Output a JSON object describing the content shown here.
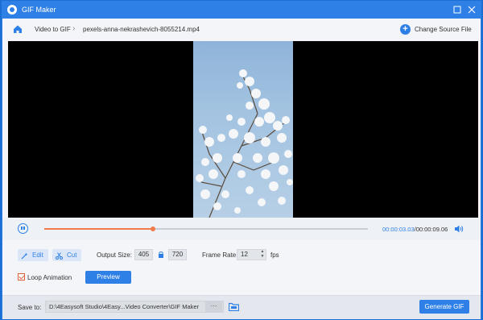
{
  "window": {
    "title": "GIF Maker"
  },
  "toolbar": {
    "breadcrumb_root": "Video to GIF",
    "breadcrumb_file": "pexels-anna-nekrashevich-8055214.mp4",
    "change_source_label": "Change Source File"
  },
  "playback": {
    "current_time": "00:00:03.03",
    "total_time": "/00:00:09.06",
    "progress_fraction": 0.335
  },
  "settings": {
    "edit_label": "Edit",
    "cut_label": "Cut",
    "output_size_label": "Output Size:",
    "width": "405",
    "height": "720",
    "frame_rate_label": "Frame Rate:",
    "frame_rate": "12",
    "fps_label": "fps",
    "loop_label": "Loop Animation",
    "loop_checked": true,
    "preview_label": "Preview"
  },
  "footer": {
    "save_to_label": "Save to:",
    "save_path": "D:\\4Easysoft Studio\\4Easy...Video Converter\\GIF Maker",
    "browse_label": "···",
    "generate_label": "Generate GIF"
  },
  "colors": {
    "accent": "#2f80e6",
    "progress": "#f07a4a"
  }
}
